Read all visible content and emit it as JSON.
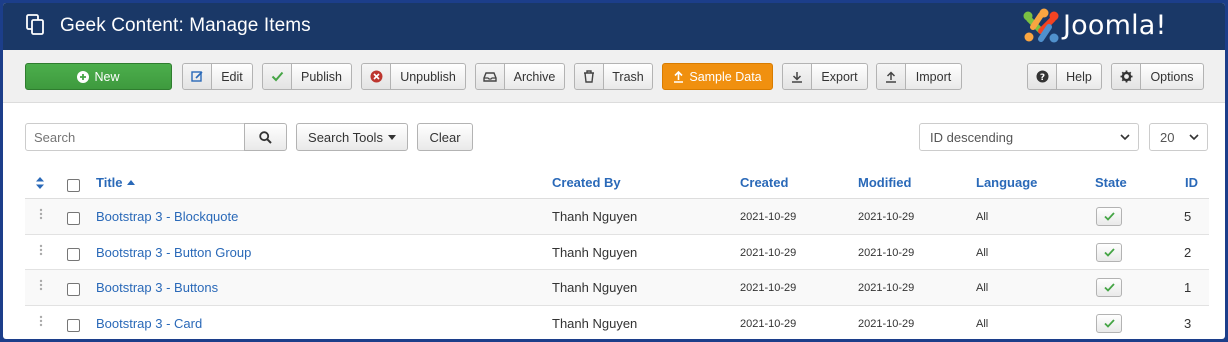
{
  "header": {
    "title": "Geek Content: Manage Items",
    "logo_text": "Joomla!"
  },
  "toolbar": {
    "new_label": "New",
    "edit_label": "Edit",
    "publish_label": "Publish",
    "unpublish_label": "Unpublish",
    "archive_label": "Archive",
    "trash_label": "Trash",
    "sample_label": "Sample Data",
    "export_label": "Export",
    "import_label": "Import",
    "help_label": "Help",
    "options_label": "Options"
  },
  "filters": {
    "search_placeholder": "Search",
    "search_tools_label": "Search Tools",
    "clear_label": "Clear",
    "ordering_value": "ID descending",
    "limit_value": "20"
  },
  "table": {
    "headers": {
      "title": "Title",
      "created_by": "Created By",
      "created": "Created",
      "modified": "Modified",
      "language": "Language",
      "state": "State",
      "id": "ID"
    },
    "rows": [
      {
        "title": "Bootstrap 3 - Blockquote",
        "created_by": "Thanh Nguyen",
        "created": "2021-10-29",
        "modified": "2021-10-29",
        "language": "All",
        "id": "5"
      },
      {
        "title": "Bootstrap 3 - Button Group",
        "created_by": "Thanh Nguyen",
        "created": "2021-10-29",
        "modified": "2021-10-29",
        "language": "All",
        "id": "2"
      },
      {
        "title": "Bootstrap 3 - Buttons",
        "created_by": "Thanh Nguyen",
        "created": "2021-10-29",
        "modified": "2021-10-29",
        "language": "All",
        "id": "1"
      },
      {
        "title": "Bootstrap 3 - Card",
        "created_by": "Thanh Nguyen",
        "created": "2021-10-29",
        "modified": "2021-10-29",
        "language": "All",
        "id": "3"
      }
    ]
  },
  "colors": {
    "header_bg": "#1a3867",
    "new_green": "#46a546",
    "sample_orange": "#f0900f",
    "link_blue": "#2a69b8"
  }
}
